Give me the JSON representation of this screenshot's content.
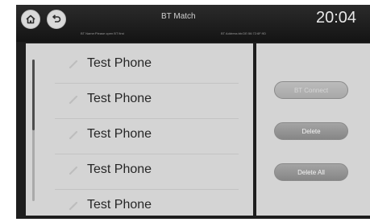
{
  "header": {
    "title": "BT Match",
    "clock": "20:04",
    "bt_name_info": "BT Name:Please open BT first",
    "bt_address_info": "BT Address:bb:DE:56:72:6F:9D"
  },
  "devices": [
    {
      "label": "Test Phone"
    },
    {
      "label": "Test Phone"
    },
    {
      "label": "Test Phone"
    },
    {
      "label": "Test Phone"
    },
    {
      "label": "Test Phone"
    }
  ],
  "actions": {
    "connect_label": "BT Connect",
    "connect_state": "disabled",
    "delete_label": "Delete",
    "delete_all_label": "Delete All"
  },
  "list_scroll_fraction_visible": 0.5,
  "icons": {
    "home": "home-icon",
    "back": "back-icon",
    "device": "link-icon"
  },
  "colors": {
    "topbar": "#1d1d1d",
    "panel": "#d4d4d4",
    "button": "#959595",
    "text": "#262626"
  }
}
